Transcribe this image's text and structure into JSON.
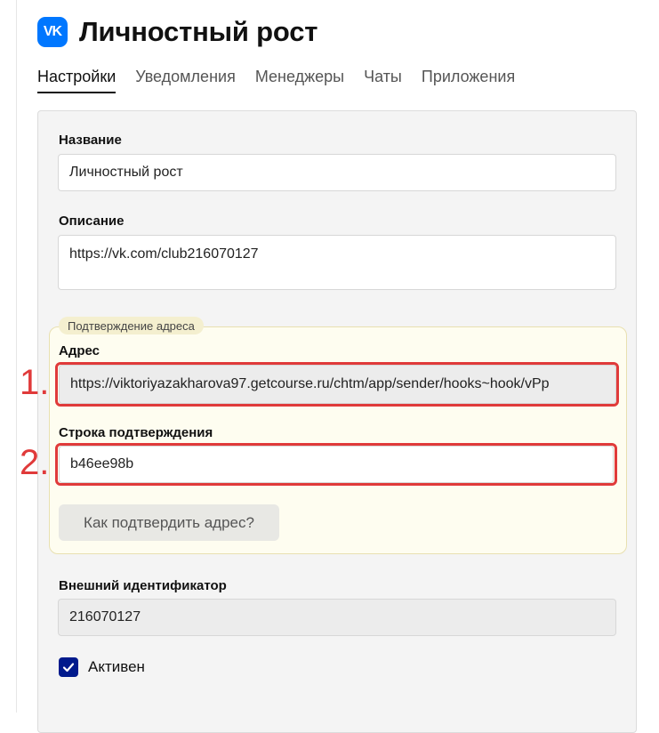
{
  "header": {
    "logo_text": "VK",
    "title": "Личностный рост"
  },
  "tabs": [
    {
      "label": "Настройки",
      "active": true
    },
    {
      "label": "Уведомления",
      "active": false
    },
    {
      "label": "Менеджеры",
      "active": false
    },
    {
      "label": "Чаты",
      "active": false
    },
    {
      "label": "Приложения",
      "active": false
    }
  ],
  "form": {
    "name_label": "Название",
    "name_value": "Личностный рост",
    "description_label": "Описание",
    "description_value": "https://vk.com/club216070127",
    "confirm_section": {
      "tag": "Подтверждение адреса",
      "address_label": "Адрес",
      "address_value": "https://viktoriyazakharova97.getcourse.ru/chtm/app/sender/hooks~hook/vPp",
      "confirm_string_label": "Строка подтверждения",
      "confirm_string_value": "b46ee98b",
      "how_button": "Как подтвердить адрес?"
    },
    "external_id_label": "Внешний идентификатор",
    "external_id_value": "216070127",
    "active_label": "Активен",
    "active_checked": true
  },
  "annotations": {
    "one": "1.",
    "two": "2."
  },
  "colors": {
    "accent": "#0077ff",
    "annotation": "#e03a3a",
    "checkbox": "#001a8c"
  }
}
